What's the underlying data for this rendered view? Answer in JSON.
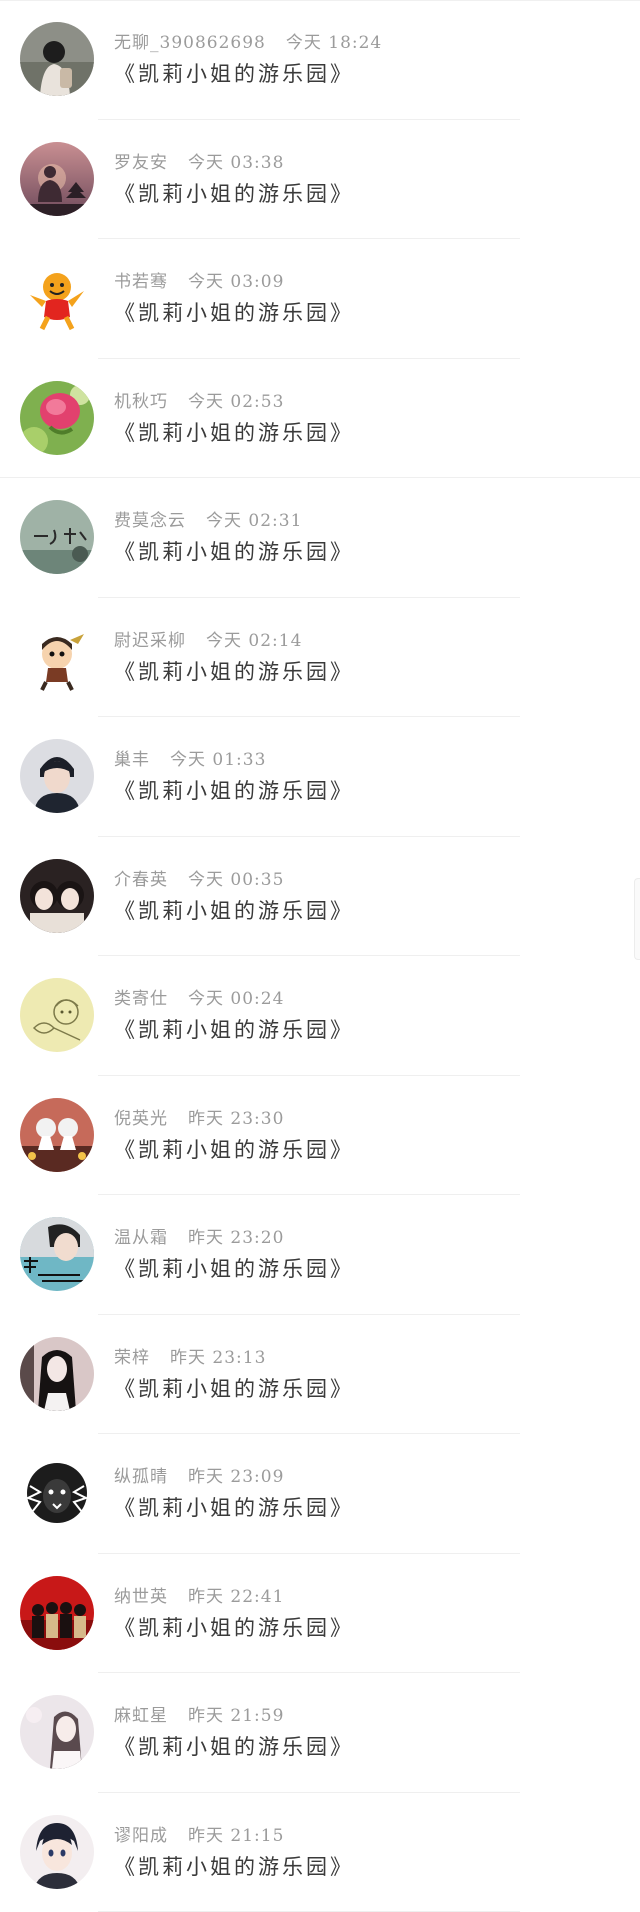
{
  "comments": [
    {
      "name": "无聊_390862698",
      "time": "今天 18:24",
      "text": "《凯莉小姐的游乐园》",
      "avatar": "girl-backpack-avatar",
      "bg": "#8d8f87"
    },
    {
      "name": "罗友安",
      "time": "今天 03:38",
      "text": "《凯莉小姐的游乐园》",
      "avatar": "buddha-sunset-avatar",
      "bg": "#b8868a"
    },
    {
      "name": "书若骞",
      "time": "今天 03:09",
      "text": "《凯莉小姐的游乐园》",
      "avatar": "cartoon-tiger-avatar",
      "bg": "#ffffff"
    },
    {
      "name": "机秋巧",
      "time": "今天 02:53",
      "text": "《凯莉小姐的游乐园》",
      "avatar": "pink-flower-avatar",
      "bg": "#7fb04f"
    },
    {
      "name": "费莫念云",
      "time": "今天 02:31",
      "text": "《凯莉小姐的游乐园》",
      "avatar": "calligraphy-wall-avatar",
      "bg": "#9fb2a6"
    },
    {
      "name": "尉迟采柳",
      "time": "今天 02:14",
      "text": "《凯莉小姐的游乐园》",
      "avatar": "cartoon-warrior-avatar",
      "bg": "#ffffff"
    },
    {
      "name": "巢丰",
      "time": "今天 01:33",
      "text": "《凯莉小姐的游乐园》",
      "avatar": "young-man-avatar",
      "bg": "#1f2530"
    },
    {
      "name": "介春英",
      "time": "今天 00:35",
      "text": "《凯莉小姐的游乐园》",
      "avatar": "two-girls-avatar",
      "bg": "#2a2222"
    },
    {
      "name": "类寄仕",
      "time": "今天 00:24",
      "text": "《凯莉小姐的游乐园》",
      "avatar": "anime-sketch-avatar",
      "bg": "#eeeab2"
    },
    {
      "name": "倪英光",
      "time": "昨天 23:30",
      "text": "《凯莉小姐的游乐园》",
      "avatar": "anime-duo-avatar",
      "bg": "#c66a5a"
    },
    {
      "name": "温从霜",
      "time": "昨天 23:20",
      "text": "《凯莉小姐的游乐园》",
      "avatar": "boy-text-avatar",
      "bg": "#6fb7c5"
    },
    {
      "name": "荣梓",
      "time": "昨天 23:13",
      "text": "《凯莉小姐的游乐园》",
      "avatar": "long-hair-girl-avatar",
      "bg": "#d9c7c7"
    },
    {
      "name": "纵孤晴",
      "time": "昨天 23:09",
      "text": "《凯莉小姐的游乐园》",
      "avatar": "lion-head-avatar",
      "bg": "#ffffff"
    },
    {
      "name": "纳世英",
      "time": "昨天 22:41",
      "text": "《凯莉小姐的游乐园》",
      "avatar": "red-group-avatar",
      "bg": "#c81818"
    },
    {
      "name": "麻虹星",
      "time": "昨天 21:59",
      "text": "《凯莉小姐的游乐园》",
      "avatar": "pale-girl-avatar",
      "bg": "#ece6ea"
    },
    {
      "name": "谬阳成",
      "time": "昨天 21:15",
      "text": "《凯莉小姐的游乐园》",
      "avatar": "anime-boy-avatar",
      "bg": "#f3eef0"
    }
  ]
}
